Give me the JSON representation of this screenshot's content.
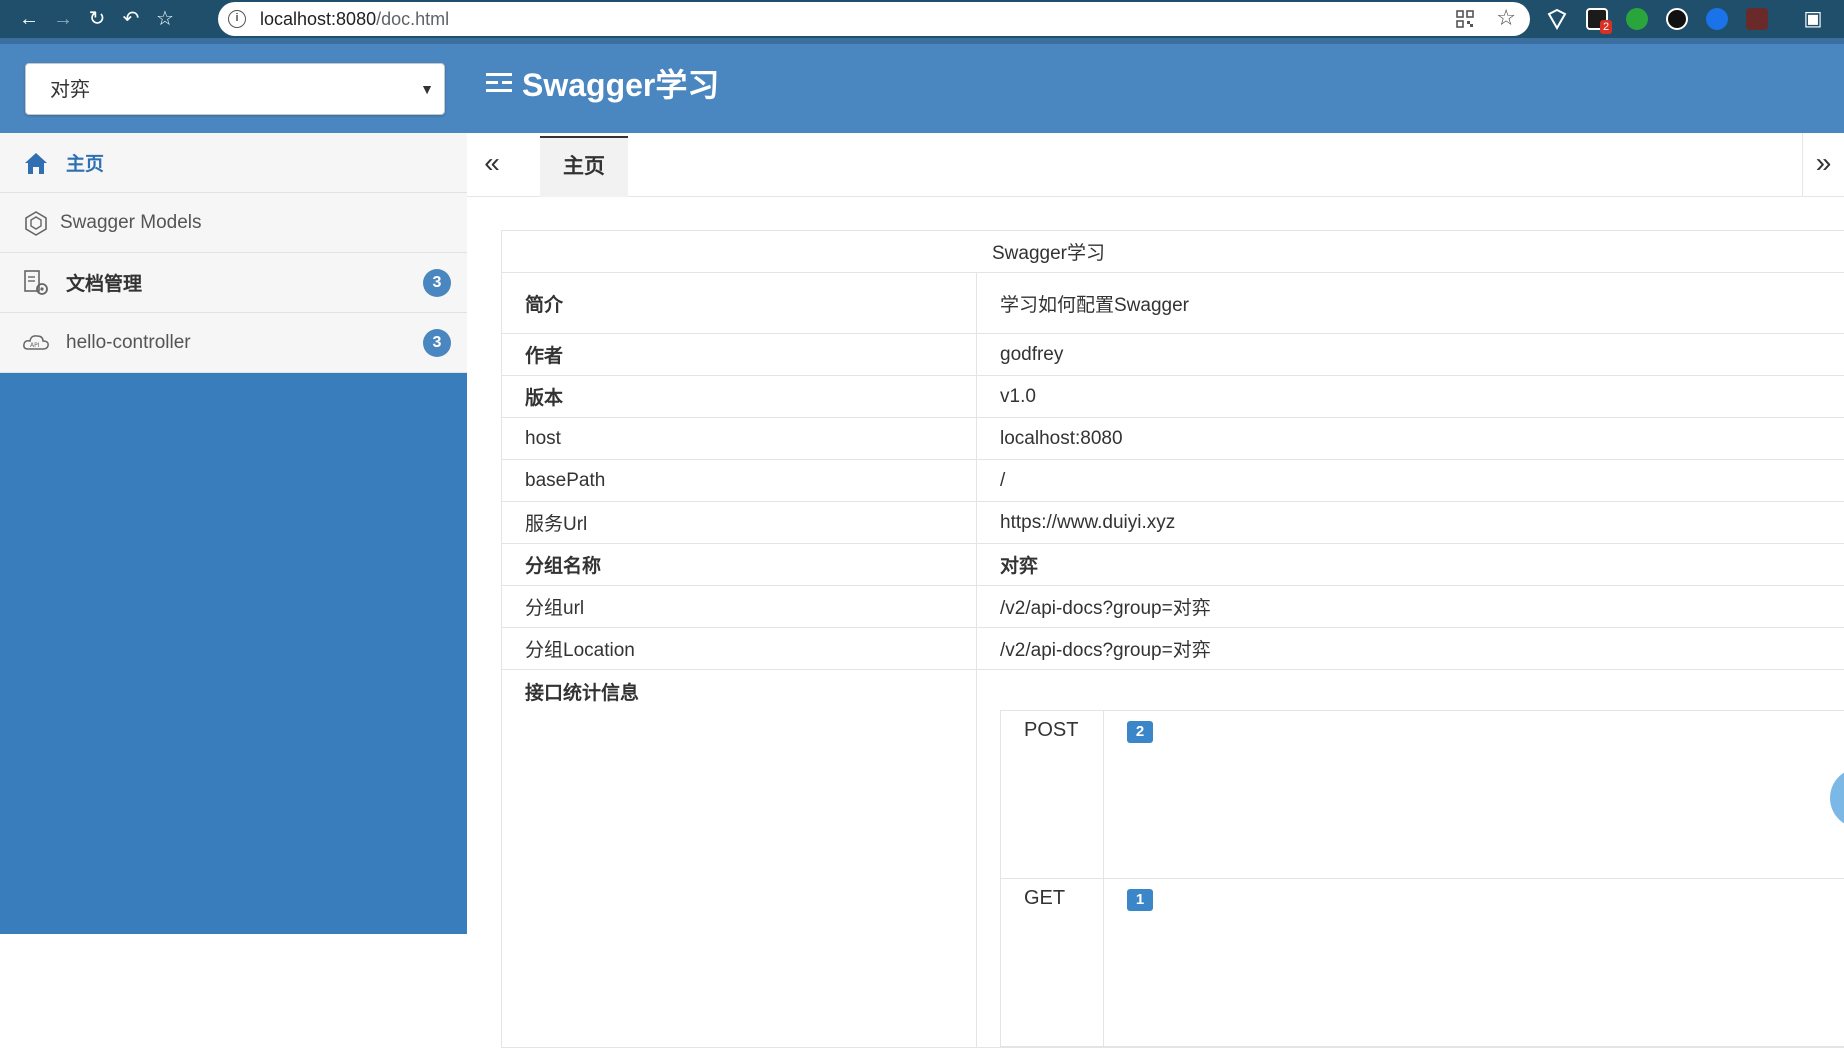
{
  "browser": {
    "url_host": "localhost:8080",
    "url_path": "/doc.html",
    "extension_badge": "2"
  },
  "header": {
    "group_select_value": "对弈",
    "brand_title": "Swagger学习"
  },
  "sidebar": {
    "items": [
      {
        "label": "主页",
        "icon": "home-icon"
      },
      {
        "label": "Swagger Models",
        "icon": "models-icon"
      },
      {
        "label": "文档管理",
        "icon": "doc-settings-icon",
        "count": "3"
      },
      {
        "label": "hello-controller",
        "icon": "api-cloud-icon",
        "count": "3"
      }
    ]
  },
  "tabs": {
    "active_label": "主页"
  },
  "info": {
    "caption": "Swagger学习",
    "rows": [
      {
        "key": "简介",
        "value": "学习如何配置Swagger"
      },
      {
        "key": "作者",
        "value": "godfrey"
      },
      {
        "key": "版本",
        "value": "v1.0"
      },
      {
        "key": "host",
        "value": "localhost:8080"
      },
      {
        "key": "basePath",
        "value": "/"
      },
      {
        "key": "服务Url",
        "value": "https://www.duiyi.xyz"
      },
      {
        "key": "分组名称",
        "value": "对弈"
      },
      {
        "key": "分组url",
        "value": "/v2/api-docs?group=对弈"
      },
      {
        "key": "分组Location",
        "value": "/v2/api-docs?group=对弈"
      },
      {
        "key": "接口统计信息",
        "value": ""
      }
    ],
    "stats": [
      {
        "method": "POST",
        "count": "2"
      },
      {
        "method": "GET",
        "count": "1"
      }
    ]
  },
  "colors": {
    "header_bg": "#4a86c0",
    "sidebar_bg": "#3a7dbd",
    "badge_bg": "#3a86c8"
  }
}
